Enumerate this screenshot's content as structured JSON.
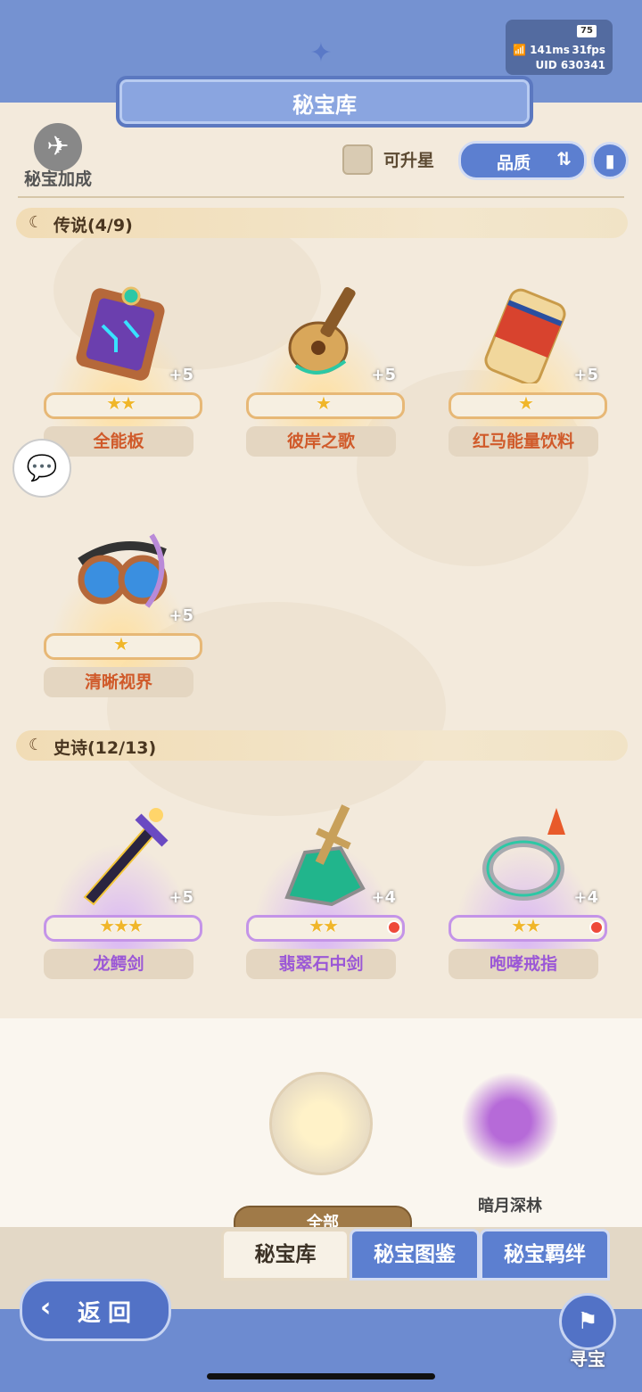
{
  "status": {
    "battery": "75",
    "ping": "141ms",
    "fps": "31fps",
    "uid": "UID 630341"
  },
  "header": {
    "title": "秘宝库"
  },
  "toolbar": {
    "bonus_label": "秘宝加成",
    "upgradable_label": "可升星",
    "sort_label": "品质",
    "sort_icon": "sort-arrows-icon",
    "info_icon": "book-icon"
  },
  "sections": [
    {
      "title": "传说(4/9)",
      "rarity": "legend",
      "items": [
        {
          "name": "全能板",
          "plus": "+5",
          "stars": "★★",
          "dot": false
        },
        {
          "name": "彼岸之歌",
          "plus": "+5",
          "stars": "★",
          "dot": false
        },
        {
          "name": "红马能量饮料",
          "plus": "+5",
          "stars": "★",
          "dot": false
        },
        {
          "name": "清晰视界",
          "plus": "+5",
          "stars": "★",
          "dot": false
        }
      ]
    },
    {
      "title": "史诗(12/13)",
      "rarity": "epic",
      "items": [
        {
          "name": "龙鳄剑",
          "plus": "+5",
          "stars": "★★★",
          "dot": false
        },
        {
          "name": "翡翠石中剑",
          "plus": "+4",
          "stars": "★★",
          "dot": true
        },
        {
          "name": "咆哮戒指",
          "plus": "+4",
          "stars": "★★",
          "dot": true
        }
      ]
    }
  ],
  "regions": [
    {
      "label": "全部",
      "selected": true
    },
    {
      "label": "暗月深林",
      "selected": false
    }
  ],
  "tabs": [
    {
      "label": "秘宝库",
      "active": true
    },
    {
      "label": "秘宝图鉴",
      "active": false
    },
    {
      "label": "秘宝羁绊",
      "active": false
    }
  ],
  "footer": {
    "back_label": "返回",
    "treasure_label": "寻宝"
  },
  "colors": {
    "accent": "#5c7fd0",
    "legend": "#d05a2a",
    "epic": "#9b58d6",
    "gold": "#f0b62a"
  }
}
